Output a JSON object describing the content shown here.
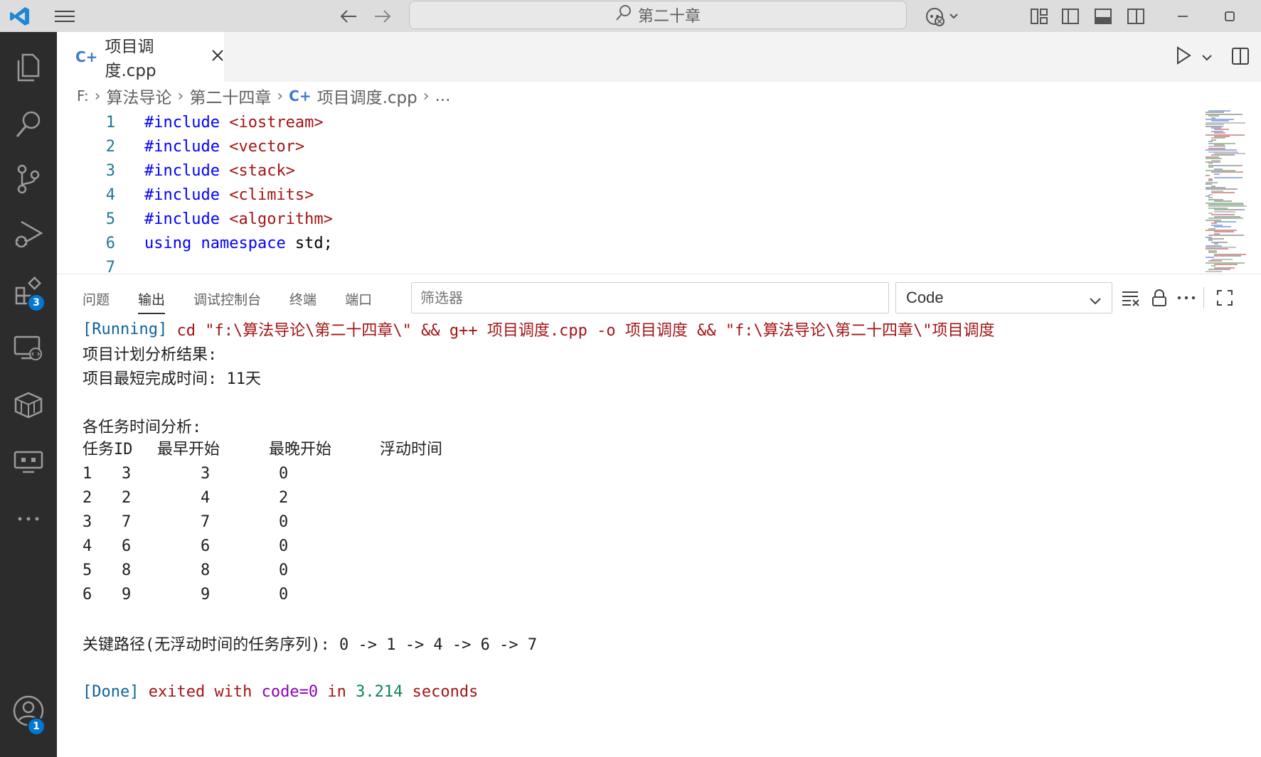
{
  "titlebar": {
    "search_text": "第二十章",
    "icons": [
      "vscode-logo-icon",
      "menu-icon",
      "arrow-left-icon",
      "arrow-right-icon",
      "search-icon",
      "copilot-icon",
      "layout-customize-icon",
      "toggle-sidebar-icon",
      "toggle-panel-icon",
      "toggle-secondary-sidebar-icon",
      "minimize-icon",
      "maximize-icon"
    ]
  },
  "activity_bar": {
    "items": [
      {
        "name": "explorer",
        "icon": "files-icon"
      },
      {
        "name": "search",
        "icon": "search-icon"
      },
      {
        "name": "source-control",
        "icon": "source-control-icon"
      },
      {
        "name": "run-debug",
        "icon": "run-debug-icon"
      },
      {
        "name": "extensions",
        "icon": "extensions-icon",
        "badge": "3"
      },
      {
        "name": "remote-explorer",
        "icon": "remote-explorer-icon"
      },
      {
        "name": "containers",
        "icon": "box-icon"
      },
      {
        "name": "remote",
        "icon": "remote-icon"
      },
      {
        "name": "more",
        "icon": "ellipsis-icon"
      }
    ],
    "accounts_badge": "1"
  },
  "tabs": {
    "active": {
      "label": "项目调度.cpp",
      "icon": "cpp-file-icon"
    }
  },
  "breadcrumb": {
    "drive": "F:",
    "parts": [
      "算法导论",
      "第二十四章"
    ],
    "file": "项目调度.cpp",
    "ellipsis": "..."
  },
  "editor": {
    "lines": [
      {
        "num": "1",
        "kw": "#include",
        "rest": " <iostream>"
      },
      {
        "num": "2",
        "kw": "#include",
        "rest": " <vector>"
      },
      {
        "num": "3",
        "kw": "#include",
        "rest": " <stack>"
      },
      {
        "num": "4",
        "kw": "#include",
        "rest": " <climits>"
      },
      {
        "num": "5",
        "kw": "#include",
        "rest": " <algorithm>"
      },
      {
        "num": "6",
        "kw": "using",
        "kw2": " namespace",
        "rest": " std;"
      },
      {
        "num": "7",
        "kw": "",
        "rest": ""
      }
    ]
  },
  "panel": {
    "tabs": [
      "问题",
      "输出",
      "调试控制台",
      "终端",
      "端口"
    ],
    "active_tab": "输出",
    "filter_placeholder": "筛选器",
    "channel": "Code",
    "output": {
      "running_tag": "[Running]",
      "running_cmd": " cd \"f:\\算法导论\\第二十四章\\\" && g++ 项目调度.cpp -o 项目调度 && \"f:\\算法导论\\第二十四章\\\"项目调度",
      "line_result": "项目计划分析结果:",
      "line_shortest": "项目最短完成时间: 11天",
      "line_analysis": "各任务时间分析:",
      "table_header": [
        "任务ID",
        "最早开始",
        "最晚开始",
        "浮动时间"
      ],
      "table_rows": [
        [
          "1",
          "3",
          "3",
          "0"
        ],
        [
          "2",
          "2",
          "4",
          "2"
        ],
        [
          "3",
          "7",
          "7",
          "0"
        ],
        [
          "4",
          "6",
          "6",
          "0"
        ],
        [
          "5",
          "8",
          "8",
          "0"
        ],
        [
          "6",
          "9",
          "9",
          "0"
        ]
      ],
      "critical_path": "关键路径(无浮动时间的任务序列): 0 -> 1 -> 4 -> 6 -> 7",
      "done_tag": "[Done]",
      "done_exited": " exited with ",
      "done_code": "code=0",
      "done_in": " in ",
      "done_time": "3.214",
      "done_seconds": " seconds"
    }
  }
}
